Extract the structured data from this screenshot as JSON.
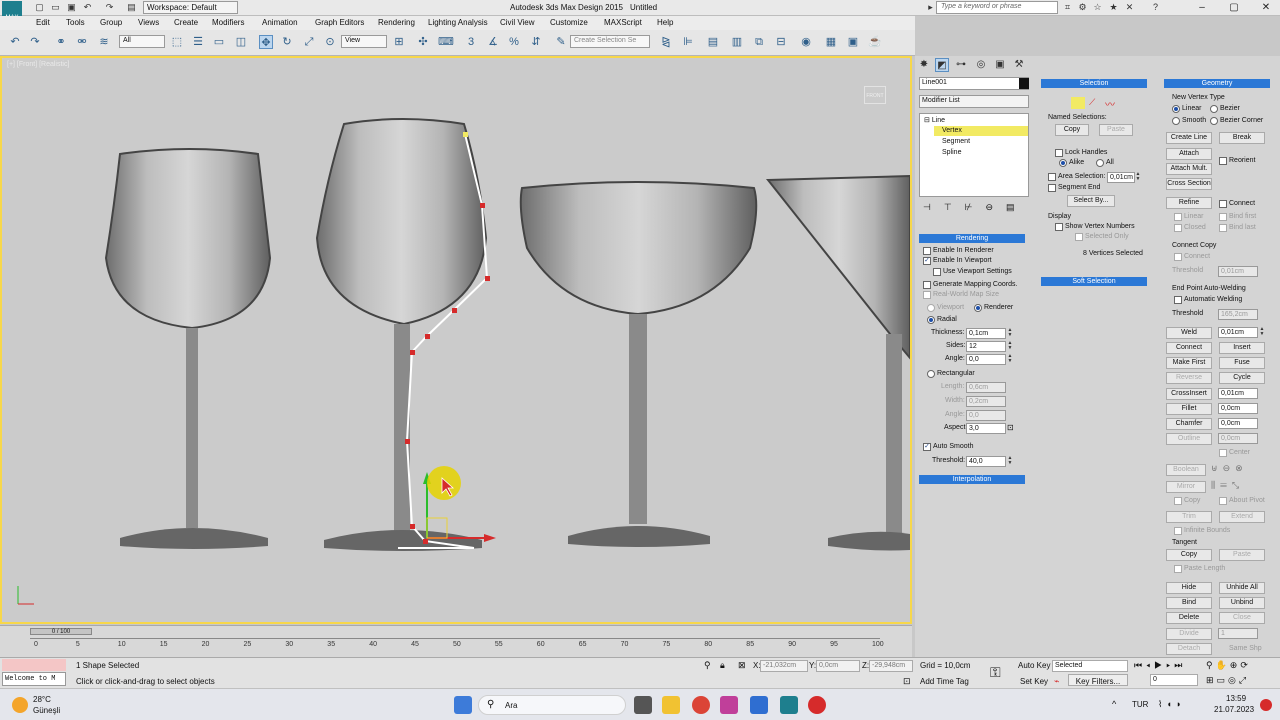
{
  "app": {
    "logo": "MAX",
    "title": "Autodesk 3ds Max Design 2015",
    "file": "Untitled",
    "workspace": "Workspace: Default",
    "search_placeholder": "Type a keyword or phrase"
  },
  "menu": [
    "Edit",
    "Tools",
    "Group",
    "Views",
    "Create",
    "Modifiers",
    "Animation",
    "Graph Editors",
    "Rendering",
    "Lighting Analysis",
    "Civil View",
    "Customize",
    "MAXScript",
    "Help"
  ],
  "toolbar": {
    "filter": "All",
    "coord": "View",
    "selection_set_placeholder": "Create Selection Se"
  },
  "viewport": {
    "label": "[+] [Front] [Realistic]",
    "cube": "FRONT"
  },
  "timeline": {
    "slider": "0 / 100",
    "ticks": [
      "0",
      "5",
      "10",
      "15",
      "20",
      "25",
      "30",
      "35",
      "40",
      "45",
      "50",
      "55",
      "60",
      "65",
      "70",
      "75",
      "80",
      "85",
      "90",
      "95",
      "100"
    ]
  },
  "status": {
    "selected": "1 Shape Selected",
    "prompt": "Click or click-and-drag to select objects",
    "listener": "Welcome to M",
    "x_label": "X:",
    "x": "-21,032cm",
    "y_label": "Y:",
    "y": "0,0cm",
    "z_label": "Z:",
    "z": "-29,948cm",
    "grid": "Grid = 10,0cm",
    "add_time_tag": "Add Time Tag",
    "auto_key": "Auto Key",
    "set_key": "Set Key",
    "key_mode": "Selected",
    "key_filters": "Key Filters...",
    "frame": "0"
  },
  "taskbar": {
    "weather_temp": "28°C",
    "weather_desc": "Güneşli",
    "search": "Ara",
    "lang": "TUR",
    "time": "13:59",
    "date": "21.07.2023"
  },
  "panel": {
    "object_name": "Line001",
    "modifier_list": "Modifier List",
    "stack": [
      "Line",
      "Vertex",
      "Segment",
      "Spline"
    ],
    "rendering": {
      "title": "Rendering",
      "enable_renderer": "Enable In Renderer",
      "enable_viewport": "Enable In Viewport",
      "use_viewport": "Use Viewport Settings",
      "gen_mapping": "Generate Mapping Coords.",
      "real_world": "Real-World Map Size",
      "viewport": "Viewport",
      "renderer": "Renderer",
      "radial": "Radial",
      "thickness_label": "Thickness:",
      "thickness": "0,1cm",
      "sides_label": "Sides:",
      "sides": "12",
      "angle_label": "Angle:",
      "angle": "0,0",
      "rectangular": "Rectangular",
      "length_label": "Length:",
      "length": "0,6cm",
      "width_label": "Width:",
      "width": "0,2cm",
      "angle2_label": "Angle:",
      "angle2": "0,0",
      "aspect_label": "Aspect:",
      "aspect": "3,0",
      "auto_smooth": "Auto Smooth",
      "threshold_label": "Threshold:",
      "threshold": "40,0"
    },
    "interpolation": "Interpolation",
    "selection": {
      "title": "Selection",
      "named": "Named Selections:",
      "copy": "Copy",
      "paste": "Paste",
      "lock_handles": "Lock Handles",
      "alike": "Alike",
      "all": "All",
      "area_selection": "Area Selection:",
      "area_value": "0,01cm",
      "segment_end": "Segment End",
      "select_by": "Select By...",
      "display": "Display",
      "show_vertex": "Show Vertex Numbers",
      "selected_only": "Selected Only",
      "status": "8 Vertices Selected"
    },
    "soft_selection": "Soft Selection",
    "geometry": {
      "title": "Geometry",
      "new_vertex_type": "New Vertex Type",
      "linear": "Linear",
      "bezier": "Bezier",
      "smooth": "Smooth",
      "bezier_corner": "Bezier Corner",
      "create_line": "Create Line",
      "break": "Break",
      "attach": "Attach",
      "reorient": "Reorient",
      "attach_mult": "Attach Mult.",
      "cross_section": "Cross Section",
      "refine": "Refine",
      "connect": "Connect",
      "linear2": "Linear",
      "bind_first": "Bind first",
      "closed": "Closed",
      "bind_last": "Bind last",
      "connect_copy": "Connect Copy",
      "connect2": "Connect",
      "threshold_label": "Threshold",
      "threshold": "0,01cm",
      "end_point": "End Point Auto-Welding",
      "auto_weld": "Automatic Welding",
      "threshold2_label": "Threshold",
      "threshold2": "165,2cm",
      "weld": "Weld",
      "weld_value": "0,01cm",
      "connect3": "Connect",
      "insert": "Insert",
      "make_first": "Make First",
      "fuse": "Fuse",
      "reverse": "Reverse",
      "cycle": "Cycle",
      "crossinsert": "CrossInsert",
      "crossinsert_value": "0,01cm",
      "fillet": "Fillet",
      "fillet_value": "0,0cm",
      "chamfer": "Chamfer",
      "chamfer_value": "0,0cm",
      "outline": "Outline",
      "outline_value": "0,0cm",
      "center": "Center",
      "boolean": "Boolean",
      "mirror": "Mirror",
      "copy": "Copy",
      "about_pivot": "About Pivot",
      "trim": "Trim",
      "extend": "Extend",
      "infinite_bounds": "Infinite Bounds",
      "tangent": "Tangent",
      "tcopy": "Copy",
      "tpaste": "Paste",
      "paste_length": "Paste Length",
      "hide": "Hide",
      "unhide_all": "Unhide All",
      "bind": "Bind",
      "unbind": "Unbind",
      "delete": "Delete",
      "close": "Close",
      "divide": "Divide",
      "divide_value": "1",
      "detach": "Detach",
      "same_shp": "Same Shp"
    }
  },
  "colors": {
    "accent": "#2b78d6",
    "viewport_border": "#f7d74a",
    "vertex": "#d62b2b",
    "highlight": "#f2ea63"
  }
}
